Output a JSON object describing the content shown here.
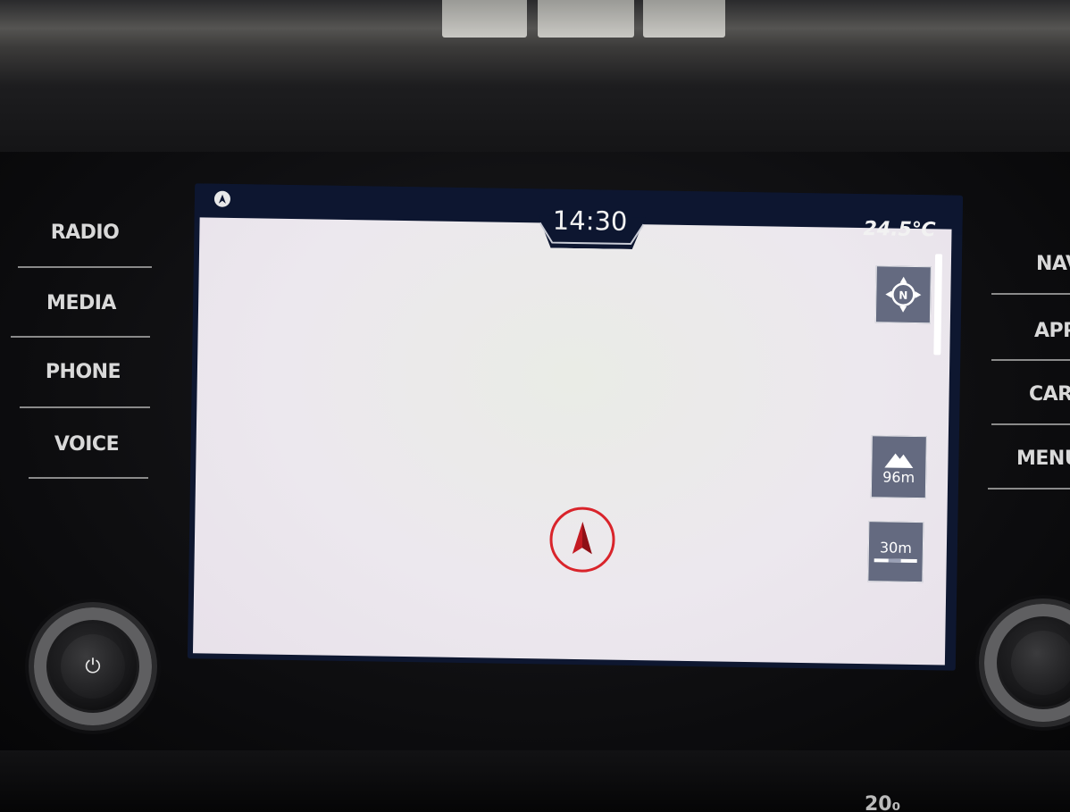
{
  "status_bar": {
    "clock": "14:30",
    "temperature": "24.5℃",
    "status_icon": "navigation-arrow-icon"
  },
  "left_keys": [
    {
      "label": "RADIO"
    },
    {
      "label": "MEDIA"
    },
    {
      "label": "PHONE"
    },
    {
      "label": "VOICE"
    }
  ],
  "right_keys": [
    {
      "label": "NAV"
    },
    {
      "label": "APP"
    },
    {
      "label": "CAR"
    },
    {
      "label": "MENU"
    }
  ],
  "map": {
    "compass_label": "N",
    "compass_icon": "compass-north-icon",
    "altitude_icon": "mountain-icon",
    "altitude_value": "96m",
    "scale_value": "30m",
    "scale_icon": "scale-bar-icon",
    "position_icon": "vehicle-position-arrow-icon"
  },
  "knobs": {
    "left_icon": "power-icon",
    "left_symbol": "⏻"
  },
  "dash": {
    "bottom_text": "20₀"
  },
  "colors": {
    "screen_bar": "#0d1630",
    "map_button": "#646a80",
    "position_marker": "#d9242b"
  }
}
